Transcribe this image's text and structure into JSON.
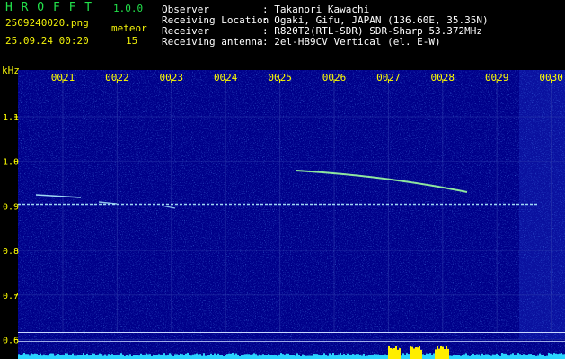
{
  "header": {
    "app_name": "H R O F F T",
    "version": "1.0.0",
    "filename": "2509240020.png",
    "datetime": "25.09.24 00:20",
    "meteor_label": "meteor",
    "meteor_count": "15",
    "info_rows": [
      {
        "label": "Observer",
        "value": ": Takanori Kawachi"
      },
      {
        "label": "Receiving Location",
        "value": ": Ogaki, Gifu, JAPAN (136.60E, 35.35N)"
      },
      {
        "label": "Receiver",
        "value": ": R820T2(RTL-SDR) SDR-Sharp 53.372MHz"
      },
      {
        "label": "Receiving antenna",
        "value": ": 2el-HB9CV Vertical (el. E-W)"
      }
    ]
  },
  "spectrogram": {
    "y_unit": "kHz",
    "time_labels": [
      "0021",
      "0022",
      "0023",
      "0024",
      "0025",
      "0026",
      "0027",
      "0028",
      "0029",
      "0030"
    ],
    "freq_labels": [
      "1.1",
      "1.0",
      "0.9",
      "0.8",
      "0.7",
      "0.6"
    ],
    "colors": {
      "background": "#00008a",
      "signal": "#b0f0ff",
      "meteor": "#9effa0",
      "level": "#2ad4ff",
      "level_peak": "#ffee00"
    }
  }
}
